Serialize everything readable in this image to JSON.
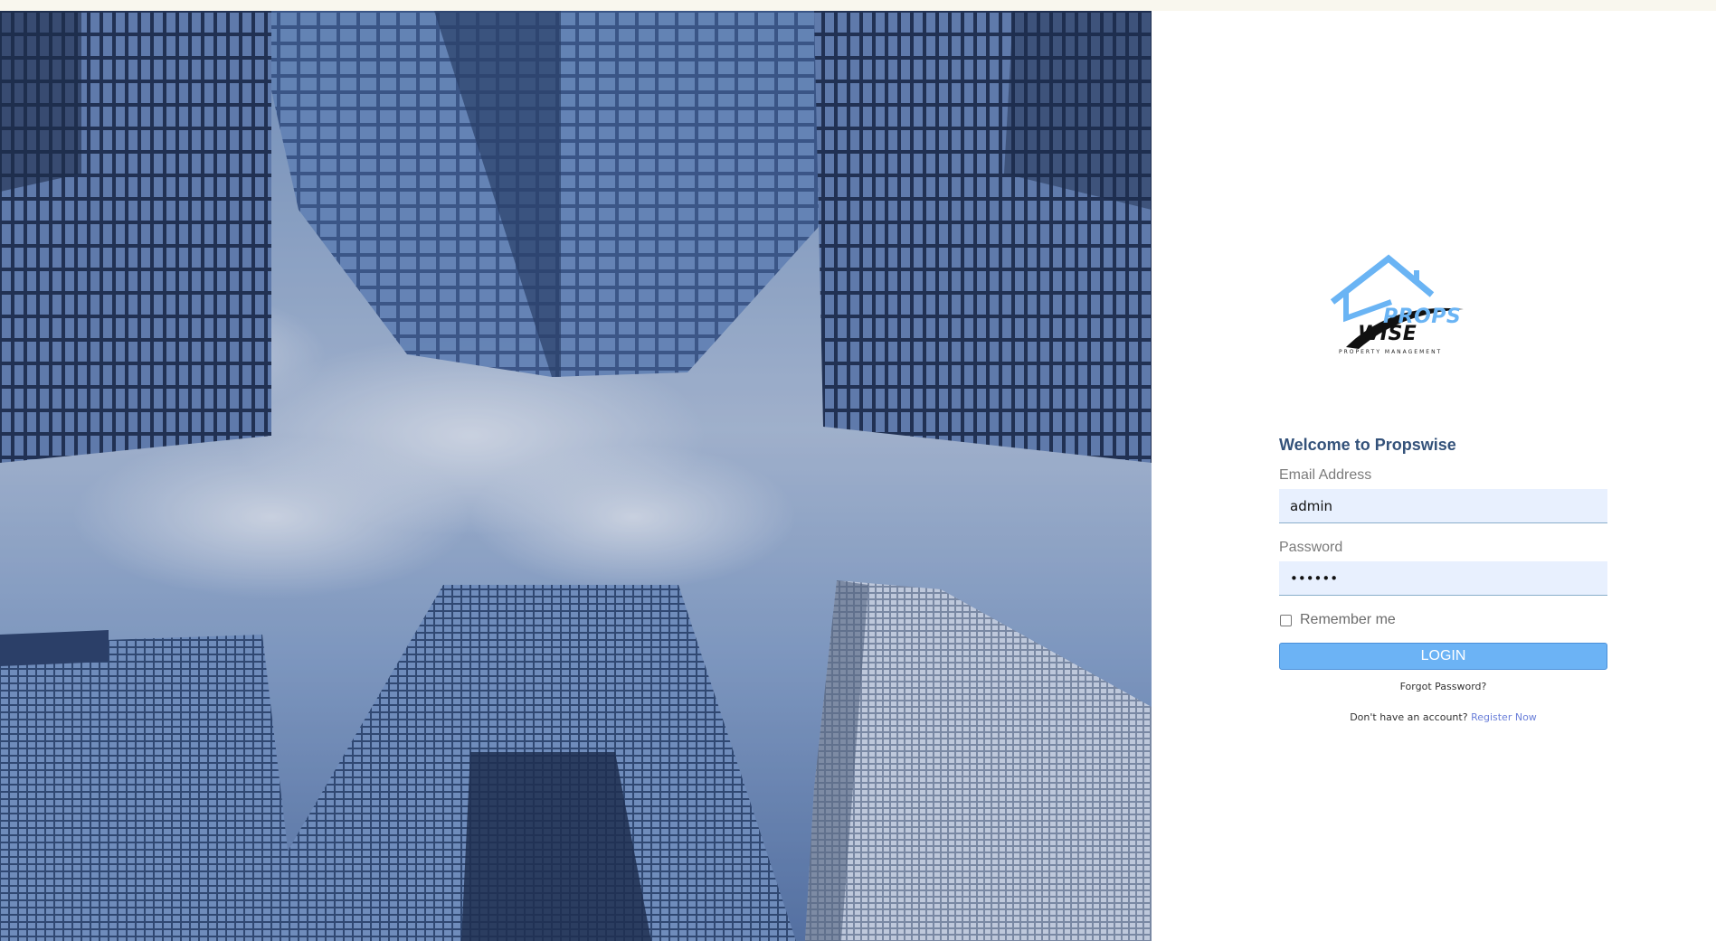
{
  "brand": {
    "logo_top": "PROPS",
    "logo_bottom": "WISE",
    "logo_subtitle": "PROPERTY MANAGEMENT",
    "accent_color": "#6ab4f4"
  },
  "hero": {
    "image": "skyscrapers-looking-up"
  },
  "login": {
    "title": "Welcome to Propswise",
    "email_label": "Email Address",
    "email_value": "admin",
    "password_label": "Password",
    "password_value": "••••••",
    "remember_label": "Remember me",
    "remember_checked": false,
    "login_button": "LOGIN",
    "forgot_link": "Forgot Password?",
    "register_prompt": "Don't have an account?",
    "register_link": "Register Now"
  }
}
